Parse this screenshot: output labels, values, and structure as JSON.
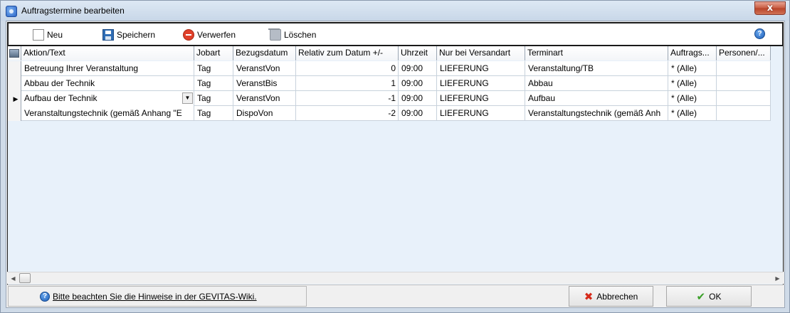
{
  "window": {
    "title": "Auftragstermine bearbeiten",
    "close_glyph": "x"
  },
  "toolbar": {
    "new_label": "Neu",
    "save_label": "Speichern",
    "discard_label": "Verwerfen",
    "delete_label": "Löschen",
    "help_glyph": "?"
  },
  "grid": {
    "columns": [
      "Aktion/Text",
      "Jobart",
      "Bezugsdatum",
      "Relativ zum Datum +/-",
      "Uhrzeit",
      "Nur bei Versandart",
      "Terminart",
      "Auftrags...",
      "Personen/..."
    ],
    "rows": [
      {
        "aktion": "Betreuung Ihrer Veranstaltung",
        "jobart": "Tag",
        "bezug": "VeranstVon",
        "relativ": "0",
        "uhrzeit": "09:00",
        "versandart": "LIEFERUNG",
        "terminart": "Veranstaltung/TB",
        "auftrags": "* (Alle)",
        "personen": ""
      },
      {
        "aktion": "Abbau der Technik",
        "jobart": "Tag",
        "bezug": "VeranstBis",
        "relativ": "1",
        "uhrzeit": "09:00",
        "versandart": "LIEFERUNG",
        "terminart": "Abbau",
        "auftrags": "* (Alle)",
        "personen": ""
      },
      {
        "aktion": "Aufbau der Technik",
        "jobart": "Tag",
        "bezug": "VeranstVon",
        "relativ": "-1",
        "uhrzeit": "09:00",
        "versandart": "LIEFERUNG",
        "terminart": "Aufbau",
        "auftrags": "* (Alle)",
        "personen": ""
      },
      {
        "aktion": "Veranstaltungstechnik (gemäß Anhang \"E",
        "jobart": "Tag",
        "bezug": "DispoVon",
        "relativ": "-2",
        "uhrzeit": "09:00",
        "versandart": "LIEFERUNG",
        "terminart": "Veranstaltungstechnik (gemäß Anh",
        "auftrags": "* (Alle)",
        "personen": ""
      }
    ],
    "current_row_index": 2,
    "current_row_marker": "▶",
    "dropdown_glyph": "▼"
  },
  "footer": {
    "wiki_text": "Bitte beachten Sie die Hinweise in der GEVITAS-Wiki.",
    "help_glyph": "?",
    "cancel_label": "Abbrechen",
    "ok_label": "OK"
  },
  "icons": {
    "cancel_glyph": "✖",
    "ok_glyph": "✔",
    "scroll_left": "◀",
    "scroll_right": "▶"
  }
}
